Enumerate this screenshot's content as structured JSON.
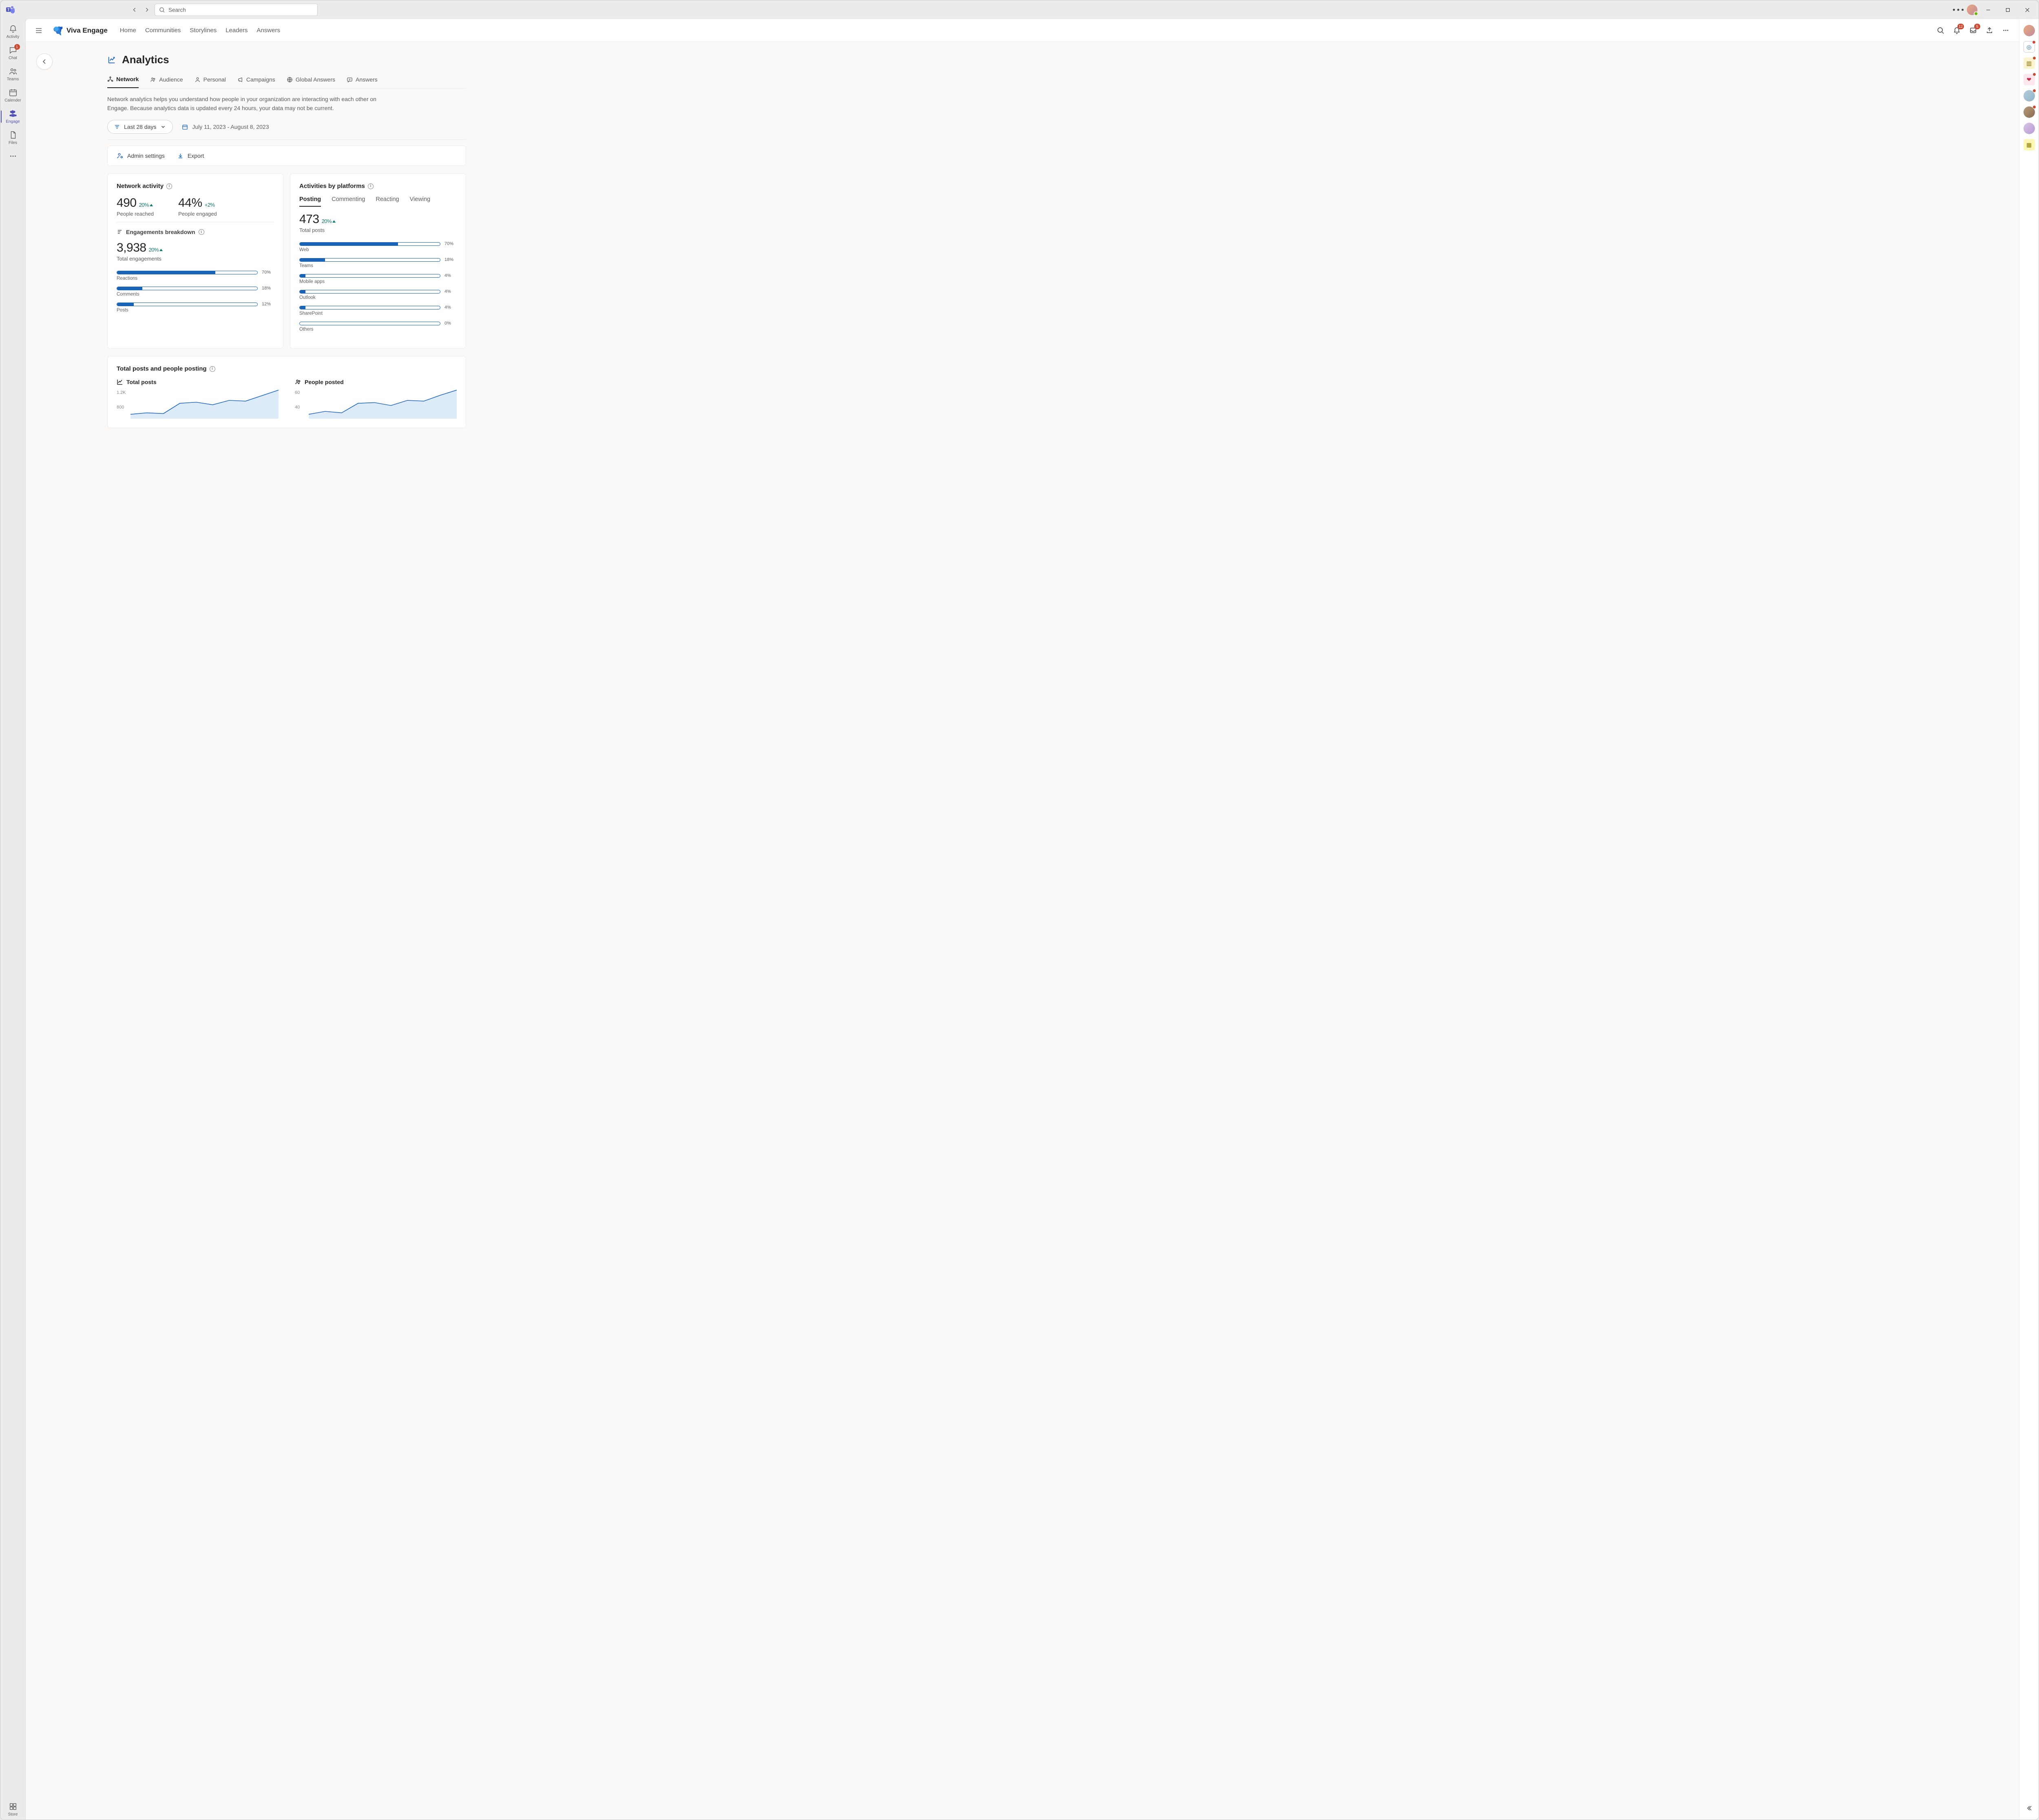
{
  "shell": {
    "search_placeholder": "Search",
    "rail": [
      {
        "key": "activity",
        "label": "Activity",
        "badge": null
      },
      {
        "key": "chat",
        "label": "Chat",
        "badge": "1"
      },
      {
        "key": "teams",
        "label": "Teams",
        "badge": null
      },
      {
        "key": "calendar",
        "label": "Calender",
        "badge": null
      },
      {
        "key": "engage",
        "label": "Engage",
        "badge": null,
        "active": true
      },
      {
        "key": "files",
        "label": "Files",
        "badge": null
      }
    ],
    "store_label": "Store"
  },
  "engage_header": {
    "brand": "Viva Engage",
    "nav": [
      "Home",
      "Communities",
      "Storylines",
      "Leaders",
      "Answers"
    ],
    "bell_badge": "12",
    "inbox_badge": "5"
  },
  "page": {
    "title": "Analytics",
    "tabs": [
      {
        "label": "Network",
        "active": true
      },
      {
        "label": "Audience"
      },
      {
        "label": "Personal"
      },
      {
        "label": "Campaigns"
      },
      {
        "label": "Global Answers"
      },
      {
        "label": "Answers"
      }
    ],
    "help": "Network analytics helps you understand how people in your organization are interacting with each other on Engage. Because analytics data is updated every 24 hours, your data may not be current.",
    "range_label": "Last 28 days",
    "date_range": "July 11, 2023 - August 8, 2023",
    "admin_label": "Admin settings",
    "export_label": "Export"
  },
  "network_activity": {
    "title": "Network activity",
    "reached": {
      "value": "490",
      "delta": "20%",
      "label": "People reached"
    },
    "engaged": {
      "value": "44%",
      "delta": "+2%",
      "label": "People engaged"
    },
    "breakdown_title": "Engagements breakdown",
    "total": {
      "value": "3,938",
      "delta": "20%",
      "label": "Total engagements"
    },
    "bars": [
      {
        "label": "Reactions",
        "pct": 70
      },
      {
        "label": "Comments",
        "pct": 18
      },
      {
        "label": "Posts",
        "pct": 12
      }
    ]
  },
  "platforms": {
    "title": "Activities by platforms",
    "tabs": [
      "Posting",
      "Commenting",
      "Reacting",
      "Viewing"
    ],
    "active_tab": "Posting",
    "total": {
      "value": "473",
      "delta": "20%",
      "label": "Total posts"
    },
    "bars": [
      {
        "label": "Web",
        "pct": 70
      },
      {
        "label": "Teams",
        "pct": 18
      },
      {
        "label": "Mobile apps",
        "pct": 4
      },
      {
        "label": "Outlook",
        "pct": 4
      },
      {
        "label": "SharePoint",
        "pct": 4
      },
      {
        "label": "Others",
        "pct": 0
      }
    ]
  },
  "posts_card": {
    "title": "Total posts and people posting",
    "left": {
      "title": "Total posts",
      "yticks": [
        "1.2K",
        "800"
      ]
    },
    "right": {
      "title": "People posted",
      "yticks": [
        "60",
        "40"
      ]
    }
  },
  "chart_data": [
    {
      "type": "area",
      "name": "Total posts",
      "ylim": [
        400,
        1200
      ],
      "yticks": [
        800,
        1200
      ],
      "x": [
        0,
        1,
        2,
        3,
        4,
        5,
        6,
        7,
        8,
        9
      ],
      "values": [
        520,
        560,
        540,
        820,
        850,
        780,
        900,
        880,
        1030,
        1180
      ]
    },
    {
      "type": "area",
      "name": "People posted",
      "ylim": [
        20,
        60
      ],
      "yticks": [
        40,
        60
      ],
      "x": [
        0,
        1,
        2,
        3,
        4,
        5,
        6,
        7,
        8,
        9
      ],
      "values": [
        26,
        30,
        28,
        41,
        42,
        38,
        45,
        44,
        52,
        59
      ]
    }
  ]
}
